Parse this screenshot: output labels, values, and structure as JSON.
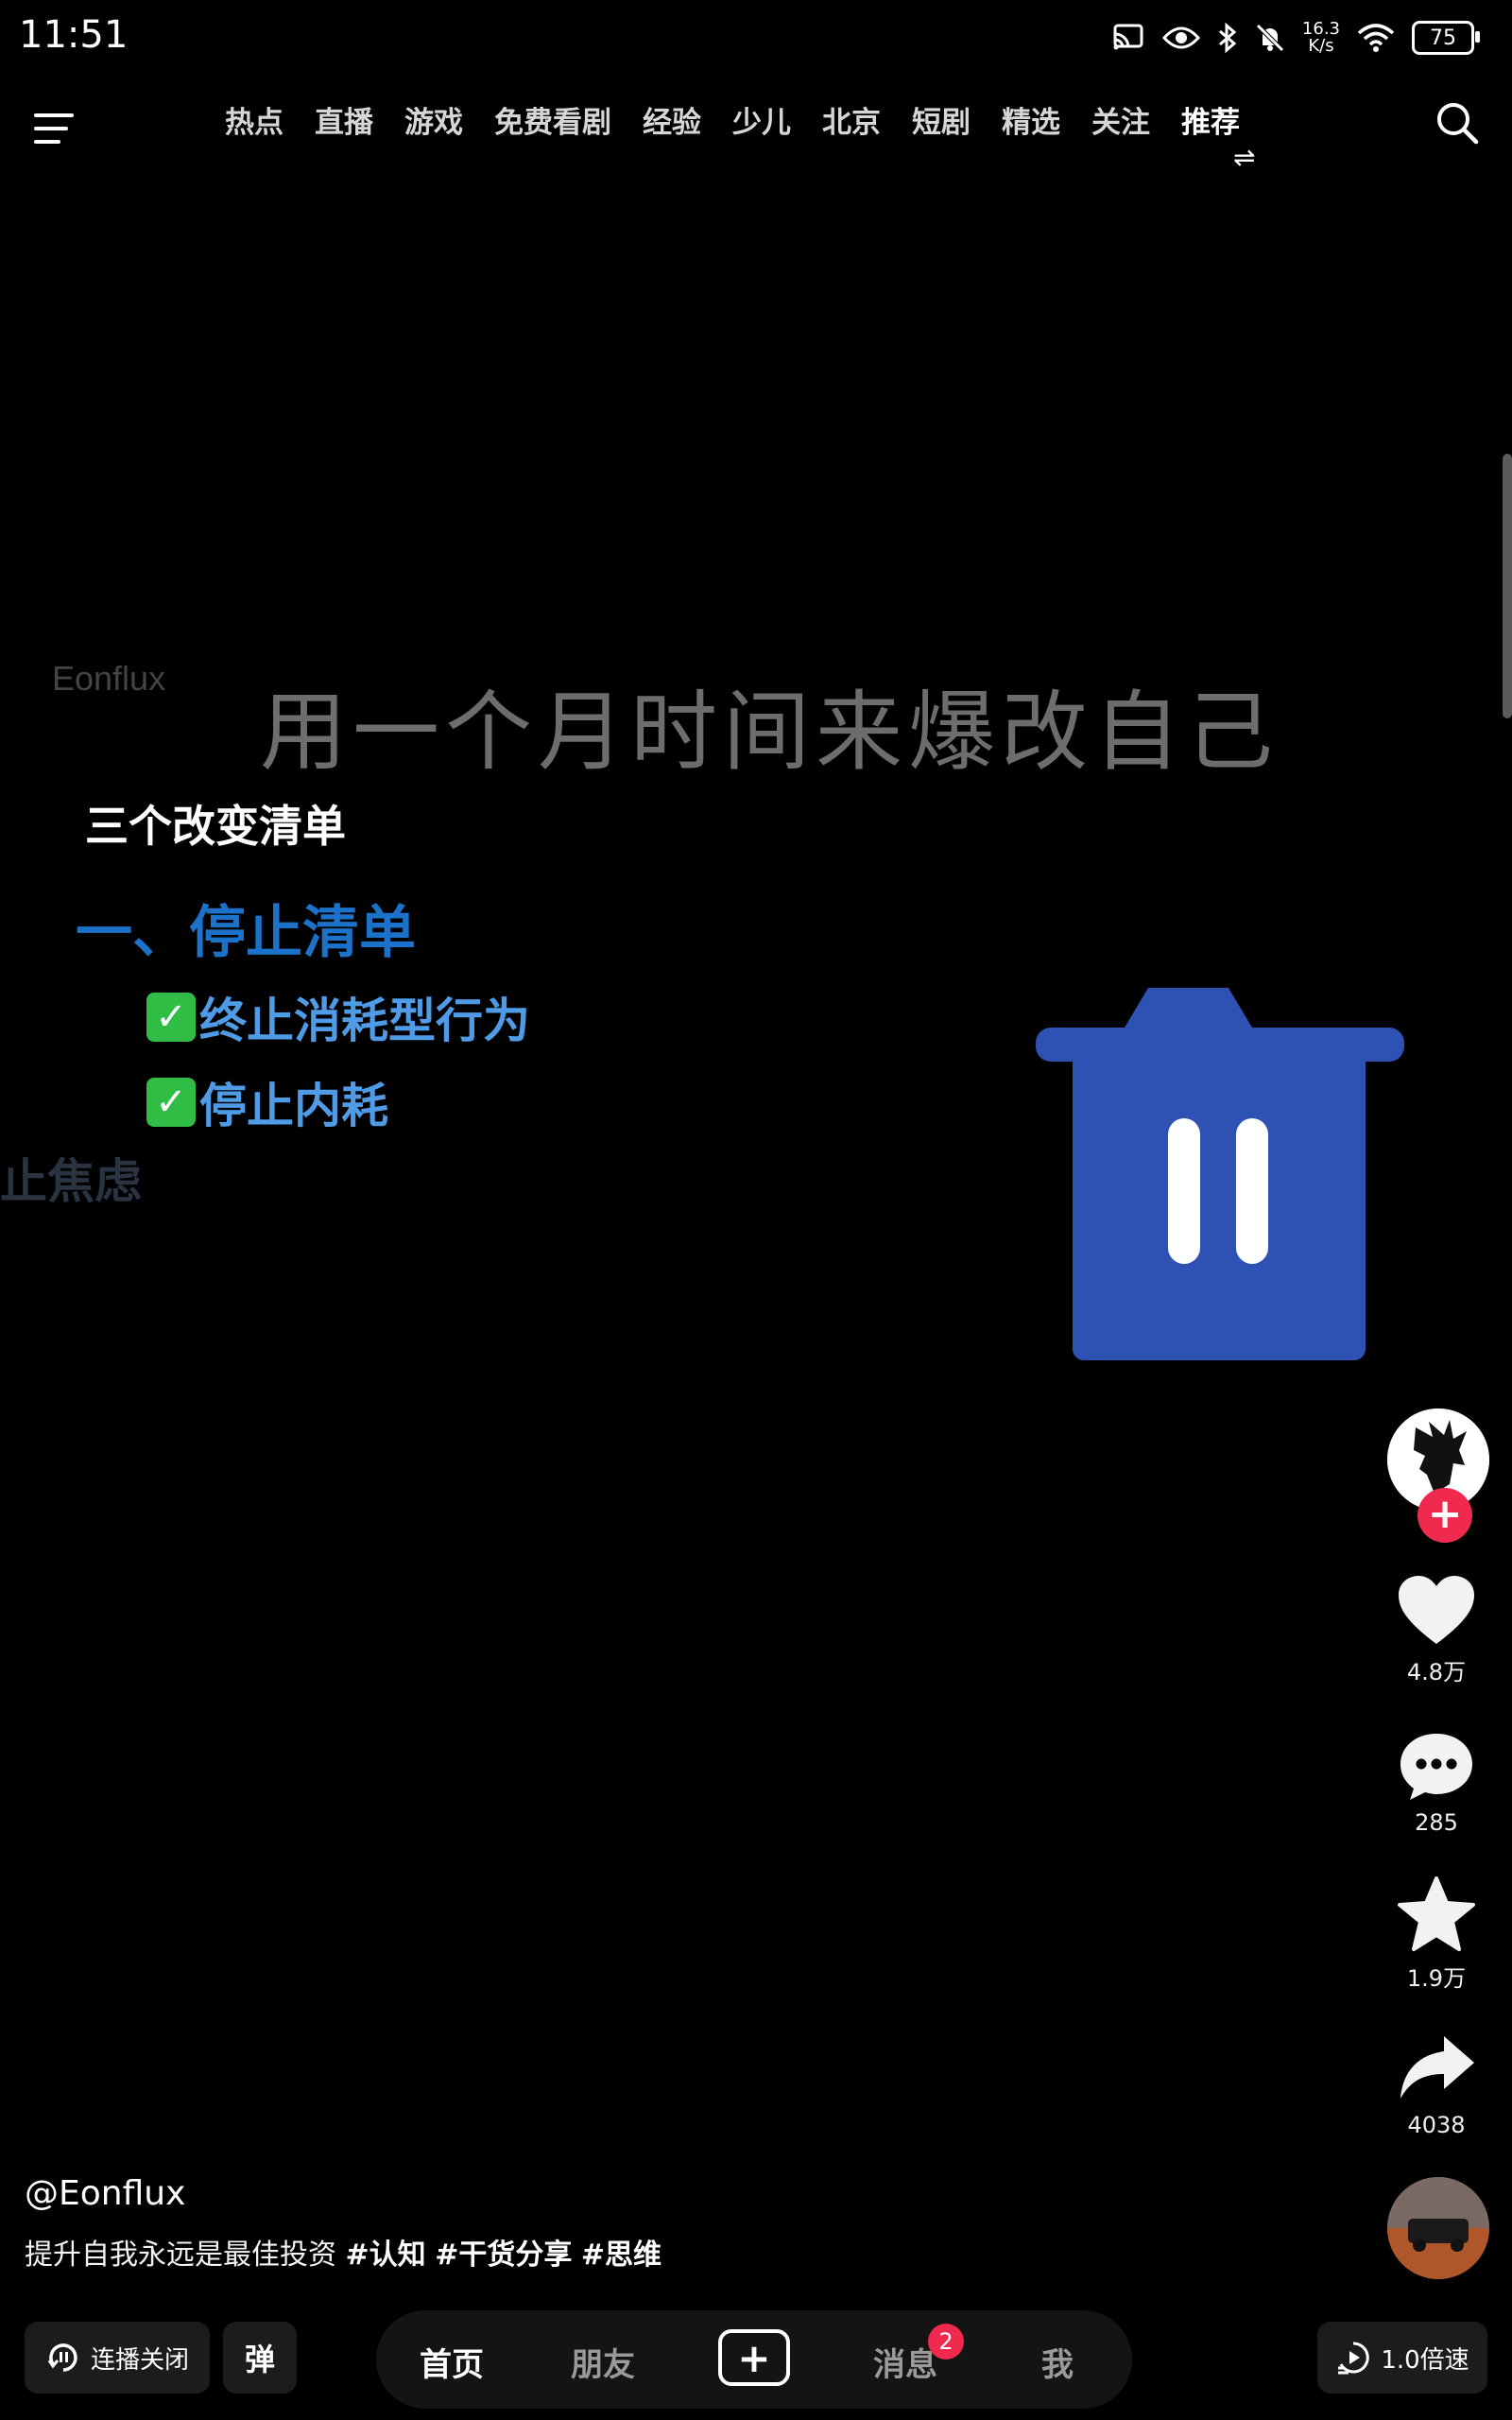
{
  "status_bar": {
    "time": "11:51",
    "net_speed_value": "16.3",
    "net_speed_unit": "K/s",
    "battery": "75",
    "icons": [
      "cast-icon",
      "eye-icon",
      "bluetooth-icon",
      "mute-icon",
      "wifi-icon",
      "battery-icon"
    ]
  },
  "top_nav": {
    "menu_icon": "menu-icon",
    "tabs": [
      {
        "label": "热点"
      },
      {
        "label": "直播"
      },
      {
        "label": "游戏"
      },
      {
        "label": "免费看剧"
      },
      {
        "label": "经验"
      },
      {
        "label": "少儿"
      },
      {
        "label": "北京"
      },
      {
        "label": "短剧"
      },
      {
        "label": "精选"
      },
      {
        "label": "关注"
      },
      {
        "label": "推荐",
        "active": true
      }
    ],
    "swap_glyph": "⇌",
    "search_icon": "search-icon"
  },
  "video": {
    "watermark": "Eonflux",
    "title": "用一个月时间来爆改自己",
    "list_title": "三个改变清单",
    "section_title": "一、停止清单",
    "items": [
      "终止消耗型行为",
      "停止内耗"
    ],
    "faded_item": "止焦虑",
    "overlay_icon": "trash-icon",
    "accent_color": "#2d52b3"
  },
  "side_actions": {
    "like_count": "4.8万",
    "comment_count": "285",
    "favorite_count": "1.9万",
    "share_count": "4038"
  },
  "caption": {
    "author": "@Eonflux",
    "text": "提升自我永远是最佳投资",
    "tags": [
      "#认知",
      "#干货分享",
      "#思维"
    ]
  },
  "bottom_bar": {
    "autoplay_label": "连播关闭",
    "danmaku_label": "弹",
    "nav": {
      "home": "首页",
      "friends": "朋友",
      "messages": "消息",
      "messages_badge": "2",
      "me": "我"
    },
    "speed_label": "1.0倍速"
  }
}
